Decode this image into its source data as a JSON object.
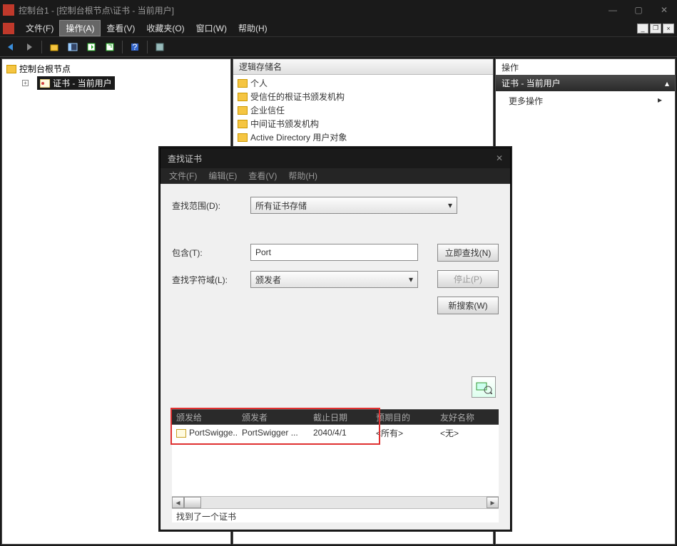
{
  "window": {
    "title": "控制台1 - [控制台根节点\\证书 - 当前用户]"
  },
  "menubar": {
    "file": "文件(F)",
    "action": "操作(A)",
    "view": "查看(V)",
    "favorites": "收藏夹(O)",
    "window": "窗口(W)",
    "help": "帮助(H)"
  },
  "tree": {
    "root": "控制台根节点",
    "cert_current_user": "证书 - 当前用户"
  },
  "center": {
    "header": "逻辑存储名",
    "folders": [
      "个人",
      "受信任的根证书颁发机构",
      "企业信任",
      "中间证书颁发机构",
      "Active Directory 用户对象"
    ]
  },
  "actions": {
    "title": "操作",
    "section": "证书 - 当前用户",
    "more": "更多操作"
  },
  "dialog": {
    "title": "查找证书",
    "menu": {
      "file": "文件(F)",
      "edit": "编辑(E)",
      "view": "查看(V)",
      "help": "帮助(H)"
    },
    "scope_label": "查找范围(D):",
    "scope_value": "所有证书存储",
    "contains_label": "包含(T):",
    "contains_value": "Port",
    "field_label": "查找字符域(L):",
    "field_value": "颁发者",
    "btn_find": "立即查找(N)",
    "btn_stop": "停止(P)",
    "btn_new": "新搜索(W)",
    "results_headers": {
      "issued_to": "颁发给",
      "issued_by": "颁发者",
      "expiry": "截止日期",
      "purpose": "预期目的",
      "friendly": "友好名称"
    },
    "results_row": {
      "issued_to": "PortSwigge...",
      "issued_by": "PortSwigger ...",
      "expiry": "2040/4/1",
      "purpose": "<所有>",
      "friendly": "<无>"
    },
    "status": "找到了一个证书"
  }
}
